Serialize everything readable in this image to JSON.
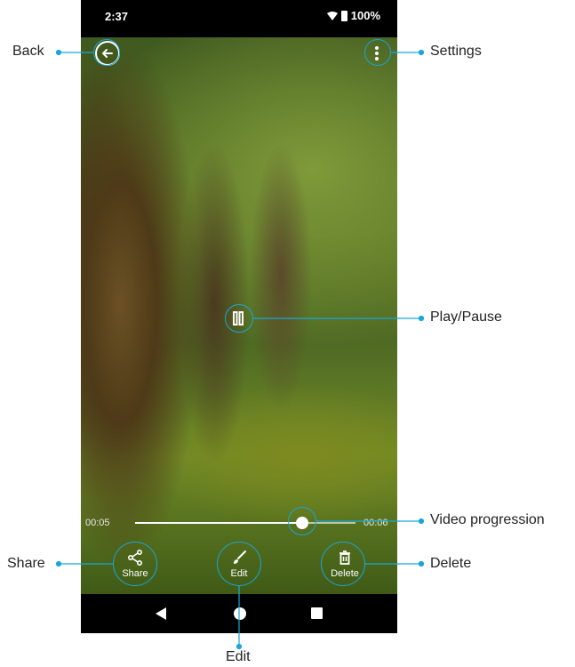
{
  "status_bar": {
    "time": "2:37",
    "battery": "100%"
  },
  "video": {
    "elapsed": "00:05",
    "total": "00:06",
    "progress_fraction": 0.76
  },
  "actions": {
    "share": "Share",
    "edit": "Edit",
    "delete": "Delete"
  },
  "callouts": {
    "back": "Back",
    "settings": "Settings",
    "play_pause": "Play/Pause",
    "video_progression": "Video progression",
    "share": "Share",
    "delete": "Delete",
    "edit": "Edit"
  },
  "colors": {
    "callout": "#1aa6d8"
  }
}
